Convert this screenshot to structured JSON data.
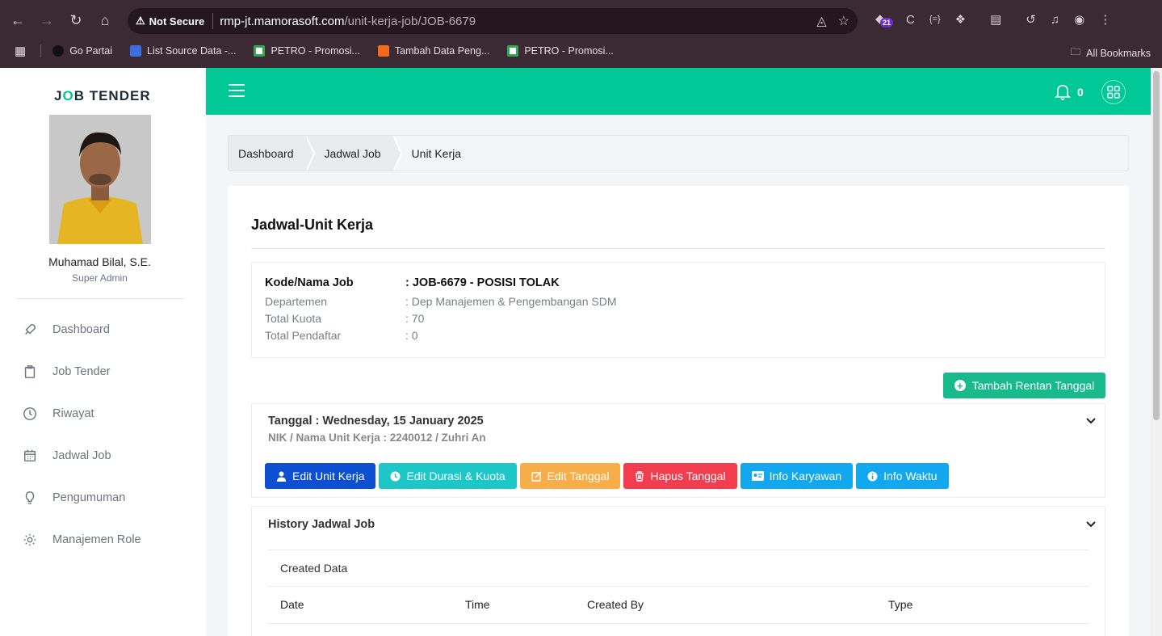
{
  "browser": {
    "not_secure_label": "Not Secure",
    "url_host": "rmp-jt.mamorasoft.com",
    "url_path": "/unit-kerja-job/JOB-6679",
    "extension_badge": "21",
    "bookmarks": [
      {
        "label": "Go Partai",
        "color": "#111111"
      },
      {
        "label": "List Source Data -...",
        "color": "#3b6fe0"
      },
      {
        "label": "PETRO - Promosi...",
        "color": "#2fa84f"
      },
      {
        "label": "Tambah Data Peng...",
        "color": "#f26b1d"
      },
      {
        "label": "PETRO - Promosi...",
        "color": "#2fa84f"
      }
    ],
    "all_bookmarks_label": "All Bookmarks"
  },
  "sidebar": {
    "logo_part1": "J",
    "logo_o": "O",
    "logo_part2": "B TENDER",
    "profile_name": "Muhamad Bilal, S.E.",
    "profile_role": "Super Admin",
    "menu": [
      {
        "label": "Dashboard",
        "icon": "rocket-icon"
      },
      {
        "label": "Job Tender",
        "icon": "clipboard-icon"
      },
      {
        "label": "Riwayat",
        "icon": "clock-icon"
      },
      {
        "label": "Jadwal Job",
        "icon": "calendar-icon"
      },
      {
        "label": "Pengumuman",
        "icon": "bulb-icon"
      },
      {
        "label": "Manajemen Role",
        "icon": "gear-icon"
      }
    ]
  },
  "topbar": {
    "notification_count": "0",
    "accent_color": "#00c897"
  },
  "breadcrumb": [
    "Dashboard",
    "Jadwal Job",
    "Unit Kerja"
  ],
  "page": {
    "title": "Jadwal-Unit Kerja",
    "info": {
      "job_label": "Kode/Nama Job",
      "job_value": ": JOB-6679 - POSISI TOLAK",
      "dept_label": "Departemen",
      "dept_value": ": Dep Manajemen & Pengembangan SDM",
      "kuota_label": "Total Kuota",
      "kuota_value": ": 70",
      "pendaftar_label": "Total Pendaftar",
      "pendaftar_value": ": 0"
    },
    "add_button": "Tambah Rentan Tanggal",
    "schedule": {
      "title": "Tanggal : Wednesday, 15 January 2025",
      "subtitle": "NIK / Nama Unit Kerja : 2240012 / Zuhri An",
      "buttons": [
        {
          "label": "Edit Unit Kerja",
          "color": "#0d4fd1",
          "icon": "user-icon"
        },
        {
          "label": "Edit Durasi & Kuota",
          "color": "#1dc7c7",
          "icon": "clock-icon"
        },
        {
          "label": "Edit Tanggal",
          "color": "#f7ae48",
          "icon": "edit-icon"
        },
        {
          "label": "Hapus Tanggal",
          "color": "#f23d4f",
          "icon": "trash-icon"
        },
        {
          "label": "Info Karyawan",
          "color": "#11a8ef",
          "icon": "id-card-icon"
        },
        {
          "label": "Info Waktu",
          "color": "#11a8ef",
          "icon": "info-icon"
        }
      ]
    },
    "history": {
      "title": "History Jadwal Job",
      "created_label": "Created Data",
      "columns": [
        "Date",
        "Time",
        "Created By",
        "Type"
      ]
    }
  }
}
